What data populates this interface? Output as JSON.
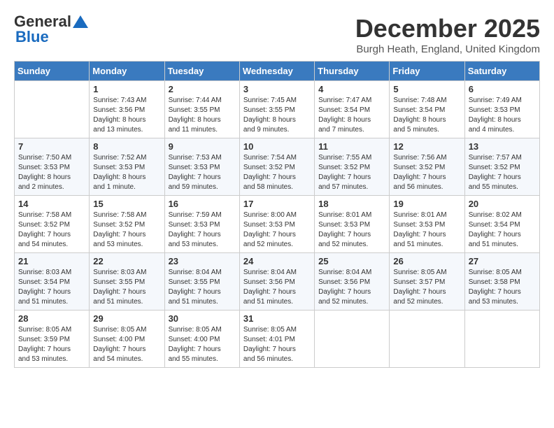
{
  "logo": {
    "general": "General",
    "blue": "Blue"
  },
  "header": {
    "month": "December 2025",
    "location": "Burgh Heath, England, United Kingdom"
  },
  "weekdays": [
    "Sunday",
    "Monday",
    "Tuesday",
    "Wednesday",
    "Thursday",
    "Friday",
    "Saturday"
  ],
  "weeks": [
    [
      {
        "day": "",
        "info": ""
      },
      {
        "day": "1",
        "info": "Sunrise: 7:43 AM\nSunset: 3:56 PM\nDaylight: 8 hours\nand 13 minutes."
      },
      {
        "day": "2",
        "info": "Sunrise: 7:44 AM\nSunset: 3:55 PM\nDaylight: 8 hours\nand 11 minutes."
      },
      {
        "day": "3",
        "info": "Sunrise: 7:45 AM\nSunset: 3:55 PM\nDaylight: 8 hours\nand 9 minutes."
      },
      {
        "day": "4",
        "info": "Sunrise: 7:47 AM\nSunset: 3:54 PM\nDaylight: 8 hours\nand 7 minutes."
      },
      {
        "day": "5",
        "info": "Sunrise: 7:48 AM\nSunset: 3:54 PM\nDaylight: 8 hours\nand 5 minutes."
      },
      {
        "day": "6",
        "info": "Sunrise: 7:49 AM\nSunset: 3:53 PM\nDaylight: 8 hours\nand 4 minutes."
      }
    ],
    [
      {
        "day": "7",
        "info": "Sunrise: 7:50 AM\nSunset: 3:53 PM\nDaylight: 8 hours\nand 2 minutes."
      },
      {
        "day": "8",
        "info": "Sunrise: 7:52 AM\nSunset: 3:53 PM\nDaylight: 8 hours\nand 1 minute."
      },
      {
        "day": "9",
        "info": "Sunrise: 7:53 AM\nSunset: 3:53 PM\nDaylight: 7 hours\nand 59 minutes."
      },
      {
        "day": "10",
        "info": "Sunrise: 7:54 AM\nSunset: 3:52 PM\nDaylight: 7 hours\nand 58 minutes."
      },
      {
        "day": "11",
        "info": "Sunrise: 7:55 AM\nSunset: 3:52 PM\nDaylight: 7 hours\nand 57 minutes."
      },
      {
        "day": "12",
        "info": "Sunrise: 7:56 AM\nSunset: 3:52 PM\nDaylight: 7 hours\nand 56 minutes."
      },
      {
        "day": "13",
        "info": "Sunrise: 7:57 AM\nSunset: 3:52 PM\nDaylight: 7 hours\nand 55 minutes."
      }
    ],
    [
      {
        "day": "14",
        "info": "Sunrise: 7:58 AM\nSunset: 3:52 PM\nDaylight: 7 hours\nand 54 minutes."
      },
      {
        "day": "15",
        "info": "Sunrise: 7:58 AM\nSunset: 3:52 PM\nDaylight: 7 hours\nand 53 minutes."
      },
      {
        "day": "16",
        "info": "Sunrise: 7:59 AM\nSunset: 3:53 PM\nDaylight: 7 hours\nand 53 minutes."
      },
      {
        "day": "17",
        "info": "Sunrise: 8:00 AM\nSunset: 3:53 PM\nDaylight: 7 hours\nand 52 minutes."
      },
      {
        "day": "18",
        "info": "Sunrise: 8:01 AM\nSunset: 3:53 PM\nDaylight: 7 hours\nand 52 minutes."
      },
      {
        "day": "19",
        "info": "Sunrise: 8:01 AM\nSunset: 3:53 PM\nDaylight: 7 hours\nand 51 minutes."
      },
      {
        "day": "20",
        "info": "Sunrise: 8:02 AM\nSunset: 3:54 PM\nDaylight: 7 hours\nand 51 minutes."
      }
    ],
    [
      {
        "day": "21",
        "info": "Sunrise: 8:03 AM\nSunset: 3:54 PM\nDaylight: 7 hours\nand 51 minutes."
      },
      {
        "day": "22",
        "info": "Sunrise: 8:03 AM\nSunset: 3:55 PM\nDaylight: 7 hours\nand 51 minutes."
      },
      {
        "day": "23",
        "info": "Sunrise: 8:04 AM\nSunset: 3:55 PM\nDaylight: 7 hours\nand 51 minutes."
      },
      {
        "day": "24",
        "info": "Sunrise: 8:04 AM\nSunset: 3:56 PM\nDaylight: 7 hours\nand 51 minutes."
      },
      {
        "day": "25",
        "info": "Sunrise: 8:04 AM\nSunset: 3:56 PM\nDaylight: 7 hours\nand 52 minutes."
      },
      {
        "day": "26",
        "info": "Sunrise: 8:05 AM\nSunset: 3:57 PM\nDaylight: 7 hours\nand 52 minutes."
      },
      {
        "day": "27",
        "info": "Sunrise: 8:05 AM\nSunset: 3:58 PM\nDaylight: 7 hours\nand 53 minutes."
      }
    ],
    [
      {
        "day": "28",
        "info": "Sunrise: 8:05 AM\nSunset: 3:59 PM\nDaylight: 7 hours\nand 53 minutes."
      },
      {
        "day": "29",
        "info": "Sunrise: 8:05 AM\nSunset: 4:00 PM\nDaylight: 7 hours\nand 54 minutes."
      },
      {
        "day": "30",
        "info": "Sunrise: 8:05 AM\nSunset: 4:00 PM\nDaylight: 7 hours\nand 55 minutes."
      },
      {
        "day": "31",
        "info": "Sunrise: 8:05 AM\nSunset: 4:01 PM\nDaylight: 7 hours\nand 56 minutes."
      },
      {
        "day": "",
        "info": ""
      },
      {
        "day": "",
        "info": ""
      },
      {
        "day": "",
        "info": ""
      }
    ]
  ]
}
